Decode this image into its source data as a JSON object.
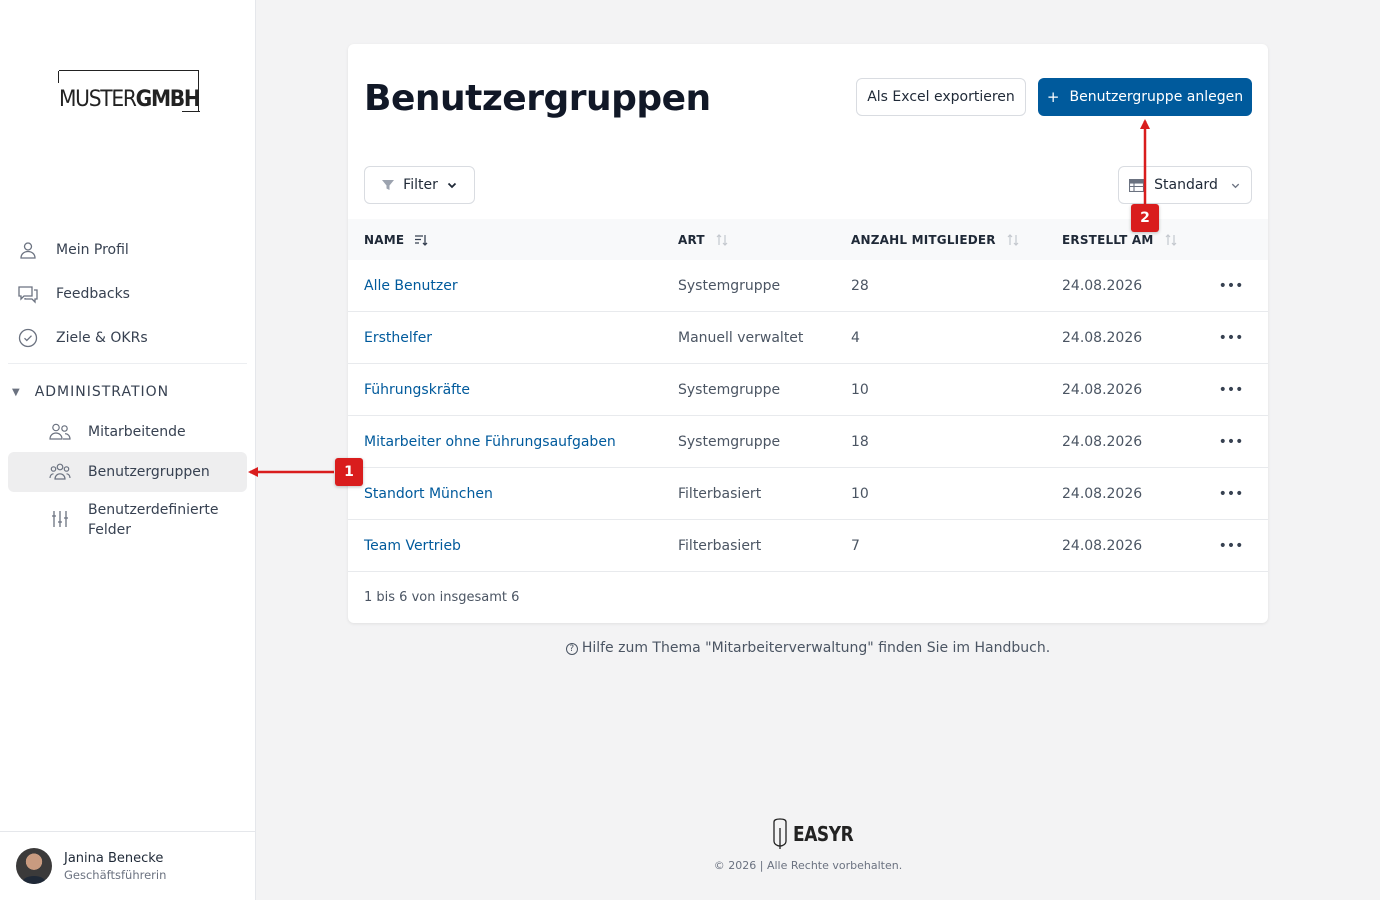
{
  "logo": {
    "part1": "MUSTER",
    "part2": "GMBH"
  },
  "sidebar": {
    "items": [
      {
        "label": "Mein Profil",
        "icon": "user-icon"
      },
      {
        "label": "Feedbacks",
        "icon": "chat-icon"
      },
      {
        "label": "Ziele & OKRs",
        "icon": "check-circle-icon"
      }
    ],
    "admin_header": "ADMINISTRATION",
    "admin_items": [
      {
        "label": "Mitarbeitende",
        "icon": "users-icon"
      },
      {
        "label": "Benutzergruppen",
        "icon": "user-group-icon",
        "active": true
      },
      {
        "label_line1": "Benutzerdefinierte",
        "label_line2": "Felder",
        "icon": "sliders-icon"
      }
    ],
    "user": {
      "name": "Janina Benecke",
      "role": "Geschäftsführerin"
    }
  },
  "main": {
    "title": "Benutzergruppen",
    "export_label": "Als Excel exportieren",
    "create_label": "Benutzergruppe anlegen",
    "create_icon": "+",
    "filter_label": "Filter",
    "view_label": "Standard",
    "columns": [
      "NAME",
      "ART",
      "ANZAHL MITGLIEDER",
      "ERSTELLT AM"
    ],
    "rows": [
      {
        "name": "Alle Benutzer",
        "art": "Systemgruppe",
        "count": "28",
        "date": "24.08.2026"
      },
      {
        "name": "Ersthelfer",
        "art": "Manuell verwaltet",
        "count": "4",
        "date": "24.08.2026"
      },
      {
        "name": "Führungskräfte",
        "art": "Systemgruppe",
        "count": "10",
        "date": "24.08.2026"
      },
      {
        "name": "Mitarbeiter ohne Führungsaufgaben",
        "art": "Systemgruppe",
        "count": "18",
        "date": "24.08.2026"
      },
      {
        "name": "Standort München",
        "art": "Filterbasiert",
        "count": "10",
        "date": "24.08.2026"
      },
      {
        "name": "Team Vertrieb",
        "art": "Filterbasiert",
        "count": "7",
        "date": "24.08.2026"
      }
    ],
    "row_menu": "•••",
    "pagination": "1 bis 6 von insgesamt 6"
  },
  "help_text": "Hilfe zum Thema \"Mitarbeiterverwaltung\" finden Sie im Handbuch.",
  "footer": {
    "brand": "EASYR",
    "copyright": "© 2026 | Alle Rechte vorbehalten."
  },
  "annotations": {
    "badge1": "1",
    "badge2": "2"
  },
  "colors": {
    "primary": "#005a9c",
    "annotation": "#d91d1d",
    "link": "#005a9c"
  }
}
